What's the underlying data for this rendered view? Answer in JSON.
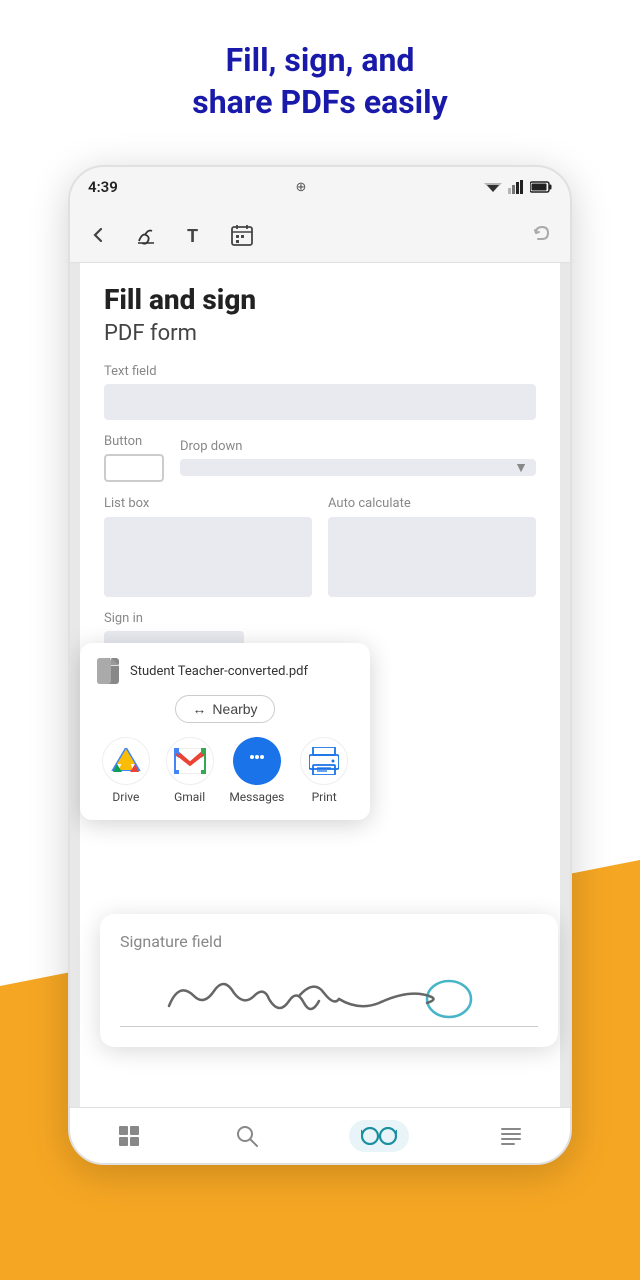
{
  "header": {
    "line1": "Fill, sign, and",
    "line2": "share PDFs easily"
  },
  "statusBar": {
    "time": "4:39",
    "icons": [
      "signal",
      "wifi",
      "battery"
    ]
  },
  "toolbar": {
    "back_label": "←",
    "sign_label": "sign-icon",
    "text_label": "T",
    "calendar_label": "📅",
    "undo_label": "↩"
  },
  "pdf": {
    "title": "Fill and sign",
    "subtitle": "PDF form",
    "textFieldLabel": "Text field",
    "buttonLabel": "Button",
    "dropDownLabel": "Drop down",
    "listBoxLabel": "List box",
    "autoCalcLabel": "Auto calculate",
    "signInLabel": "Sign in"
  },
  "sharePopup": {
    "filename": "Student Teacher-converted.pdf",
    "nearbyLabel": "Nearby",
    "apps": [
      {
        "name": "Drive",
        "icon": "drive"
      },
      {
        "name": "Gmail",
        "icon": "gmail"
      },
      {
        "name": "Messages",
        "icon": "messages"
      },
      {
        "name": "Print",
        "icon": "print"
      }
    ]
  },
  "signaturePopup": {
    "label": "Signature field"
  },
  "bottomNav": {
    "icons": [
      "grid",
      "search",
      "glasses",
      "list"
    ]
  }
}
